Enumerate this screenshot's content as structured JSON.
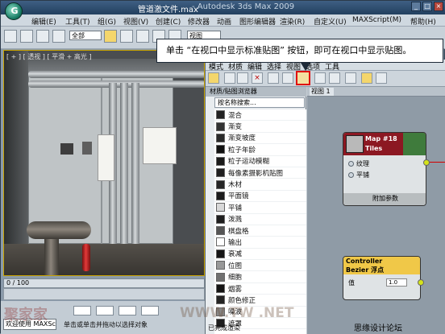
{
  "window": {
    "logo": "G",
    "title": "管道激文件.max",
    "title_sub": "- Autodesk 3ds Max 2009",
    "buttons": [
      "_",
      "□",
      "×"
    ]
  },
  "menu": [
    "编辑(E)",
    "工具(T)",
    "组(G)",
    "视图(V)",
    "创建(C)",
    "修改器",
    "动画",
    "图形编辑器",
    "渲染(R)",
    "自定义(U)",
    "MAXScript(M)",
    "帮助(H)"
  ],
  "toolbar": {
    "selection_filter": "全部",
    "view_dropdown": "视图"
  },
  "viewport": {
    "label": "[ + ] [ 透视 ] [ 平滑 + 高光 ]"
  },
  "timeline": {
    "frame": "0 / 100"
  },
  "status": {
    "welcome": "欢迎使用 MAXSc",
    "hint": "单击或单击并拖动以选择对象",
    "bottom": "已完成渲染"
  },
  "slate_editor": {
    "menus": [
      "模式",
      "材质",
      "编辑",
      "选择",
      "视图",
      "选项",
      "工具"
    ],
    "view_tab": "视图 1",
    "browser_title": "材质/贴图浏览器",
    "browser_search": "按名称搜索...",
    "maps": [
      {
        "name": "混合",
        "swatch": "#222222"
      },
      {
        "name": "渐变",
        "swatch": "#333333"
      },
      {
        "name": "渐变坡度",
        "swatch": "#2a2a2a"
      },
      {
        "name": "粒子年龄",
        "swatch": "#111111"
      },
      {
        "name": "粒子运动模糊",
        "swatch": "#1a1a1a"
      },
      {
        "name": "每像素摄影机贴图",
        "swatch": "#202020"
      },
      {
        "name": "木材",
        "swatch": "#262626"
      },
      {
        "name": "平面镜",
        "swatch": "#1c1c1c"
      },
      {
        "name": "平铺",
        "swatch": "#d8d8d8"
      },
      {
        "name": "泼溅",
        "swatch": "#1f1f1f"
      },
      {
        "name": "棋盘格",
        "swatch": "#555555"
      },
      {
        "name": "输出",
        "swatch": "#ffffff"
      },
      {
        "name": "衰减",
        "swatch": "#161616"
      },
      {
        "name": "位图",
        "swatch": "#999999"
      },
      {
        "name": "细胞",
        "swatch": "#707070"
      },
      {
        "name": "烟雾",
        "swatch": "#141414"
      },
      {
        "name": "颜色修正",
        "swatch": "#242424"
      },
      {
        "name": "噪波",
        "swatch": "#888888"
      },
      {
        "name": "遮罩",
        "swatch": "#1e1e1e"
      }
    ],
    "node_map": {
      "title1": "Map #18",
      "title2": "Tiles",
      "slots": [
        "纹理",
        "平铺"
      ],
      "footer": "附加参数"
    },
    "node_controller": {
      "title1": "Controller",
      "title2": "Bezier 浮点",
      "slot": "值",
      "value": "1.0"
    }
  },
  "callout": "单击 “在视口中显示标准贴图” 按钮，即可在视口中显示贴图。",
  "watermarks": {
    "left": "聚家家",
    "center": "WWW.TW          .NET",
    "right": "思缘设计论坛"
  },
  "colors": {
    "highlight_border": "#e01010",
    "node_map_head": "#8c1822",
    "node_ctrl_head": "#f0c848"
  }
}
